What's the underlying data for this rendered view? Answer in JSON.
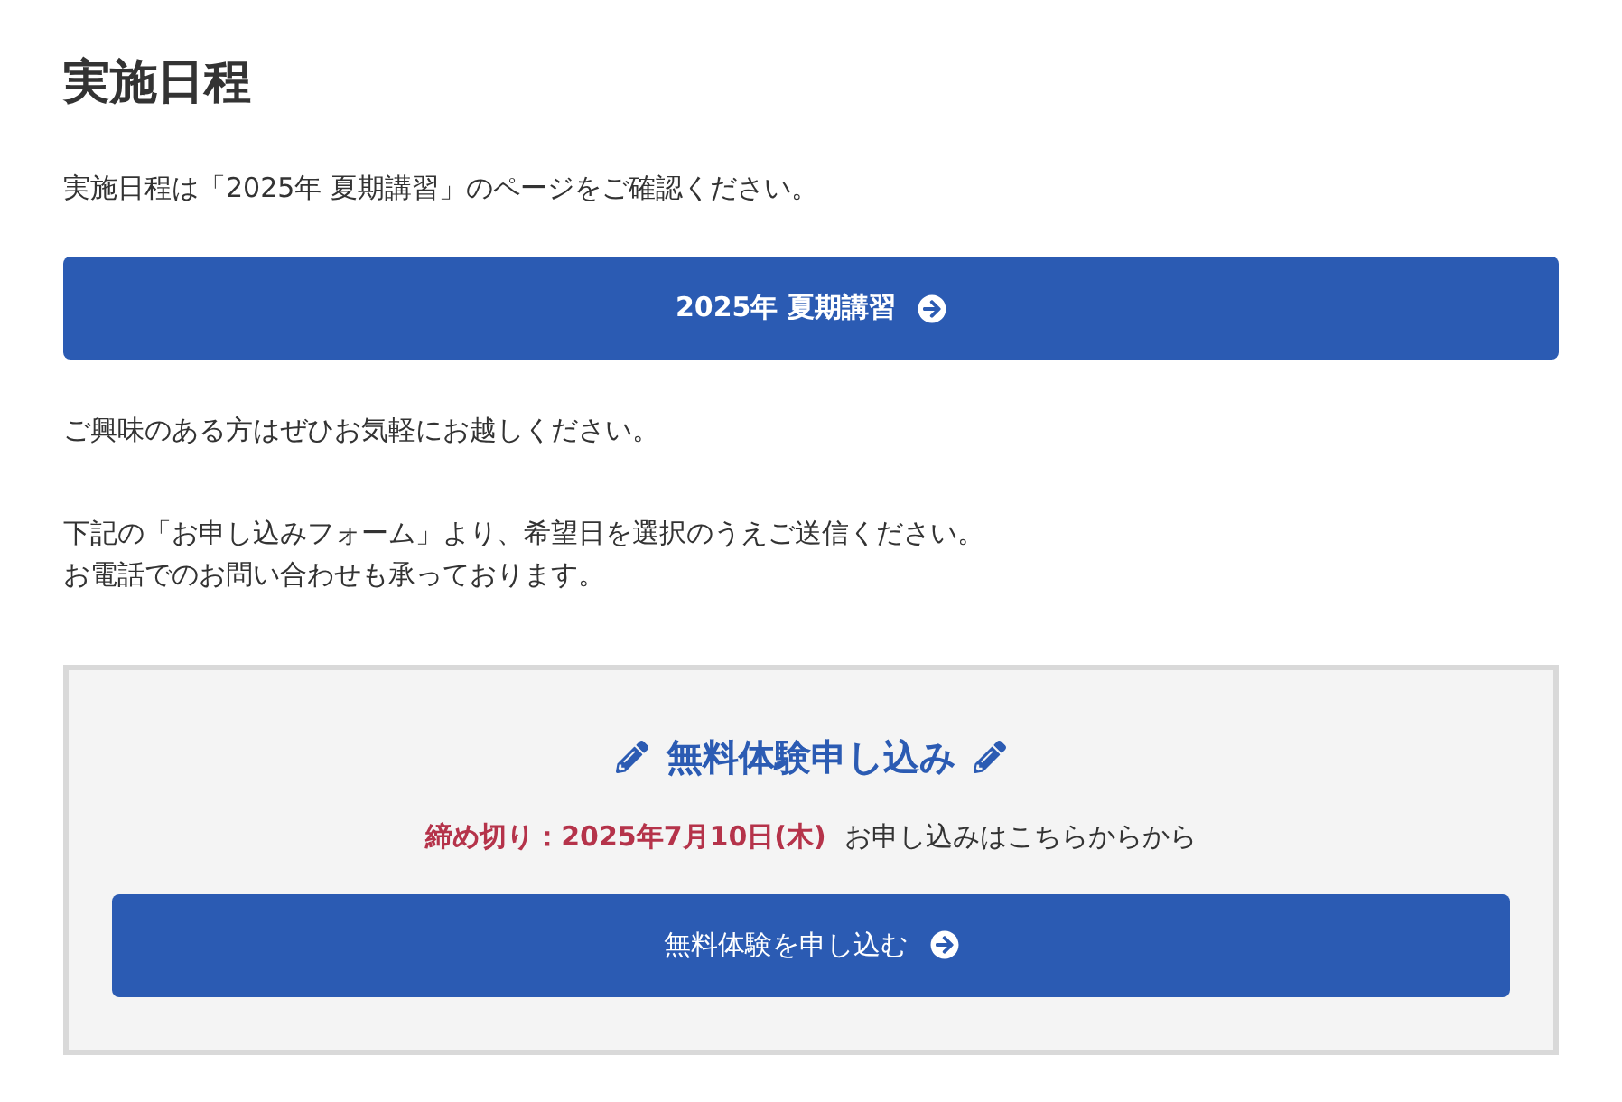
{
  "heading": "実施日程",
  "intro": "実施日程は「2025年 夏期講習」のページをご確認ください。",
  "link_button": {
    "label": "2025年 夏期講習"
  },
  "paragraphs": [
    {
      "lines": [
        "ご興味のある方はぜひお気軽にお越しください。"
      ]
    },
    {
      "lines": [
        "下記の「お申し込みフォーム」より、希望日を選択のうえご送信ください。",
        "お電話でのお問い合わせも承っております。"
      ]
    }
  ],
  "signup": {
    "title": "無料体験申し込み",
    "deadline": "締め切り：2025年7月10日(木)",
    "note": "お申し込みはこちらからから",
    "button": {
      "label": "無料体験を申し込む"
    }
  }
}
